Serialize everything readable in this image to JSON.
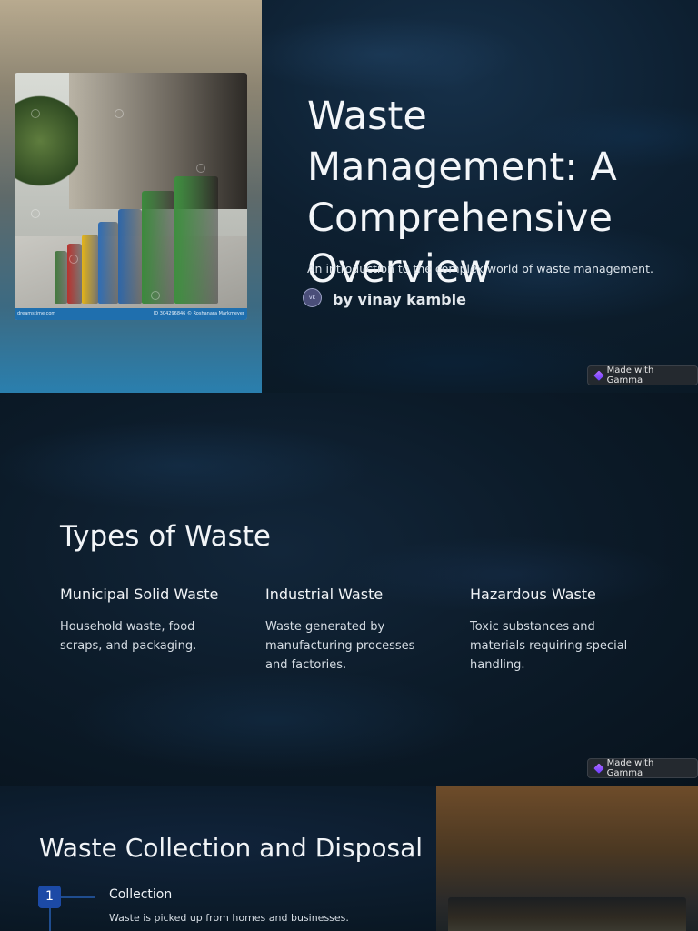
{
  "slide1": {
    "title": "Waste Management: A Comprehensive Overview",
    "subtitle": "An introduction to the complex world of waste management.",
    "author_initials": "vk",
    "author": "by vinay kamble",
    "photo_banner_left": "dreamstime.com",
    "photo_banner_right": "ID 304296846 © Roshanara Markmeyer",
    "badge": "Made with Gamma"
  },
  "slide2": {
    "title": "Types of Waste",
    "types": [
      {
        "heading": "Municipal Solid Waste",
        "text": "Household waste, food scraps, and packaging."
      },
      {
        "heading": "Industrial Waste",
        "text": "Waste generated by manufacturing processes and factories."
      },
      {
        "heading": "Hazardous Waste",
        "text": "Toxic substances and materials requiring special handling."
      }
    ],
    "badge": "Made with Gamma"
  },
  "slide3": {
    "title": "Waste Collection and Disposal",
    "steps": [
      {
        "number": "1",
        "title": "Collection",
        "text": "Waste is picked up from homes and businesses."
      }
    ]
  },
  "colors": {
    "accent": "#1c4aa6",
    "background": "#0a1722",
    "bins": [
      "#3f7a3a",
      "#b8322e",
      "#e3b318",
      "#2f6db5",
      "#2e66a8",
      "#3b8a3c",
      "#3e8f3f"
    ]
  }
}
